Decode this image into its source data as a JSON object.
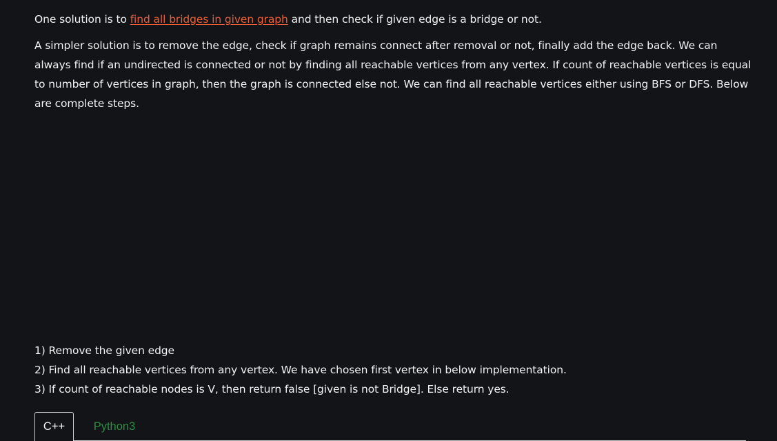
{
  "article": {
    "para1": {
      "before": "One solution is to ",
      "link": "find all bridges in given graph",
      "after": " and then check if given edge is a bridge or not."
    },
    "para2": "A simpler solution is to remove the edge, check if graph remains connect after removal or not, finally add the edge back. We can always find if an undirected is connected or not by finding all reachable vertices from any vertex. If count of reachable vertices is equal to number of vertices in graph, then the graph is connected else not. We can find all reachable vertices either using BFS or DFS. Below are complete steps.",
    "steps": [
      "1) Remove the given edge",
      "2) Find all reachable vertices from any vertex. We have chosen first vertex in below implementation.",
      "3) If count of reachable nodes is V, then return false [given is not Bridge]. Else return yes."
    ]
  },
  "code_tabs": [
    {
      "label": "C++",
      "active": true
    },
    {
      "label": "Python3",
      "active": false
    }
  ],
  "colors": {
    "background": "#131417",
    "text": "#f2f2f2",
    "link": "#e8613b",
    "tab_inactive": "#2f8d46"
  }
}
